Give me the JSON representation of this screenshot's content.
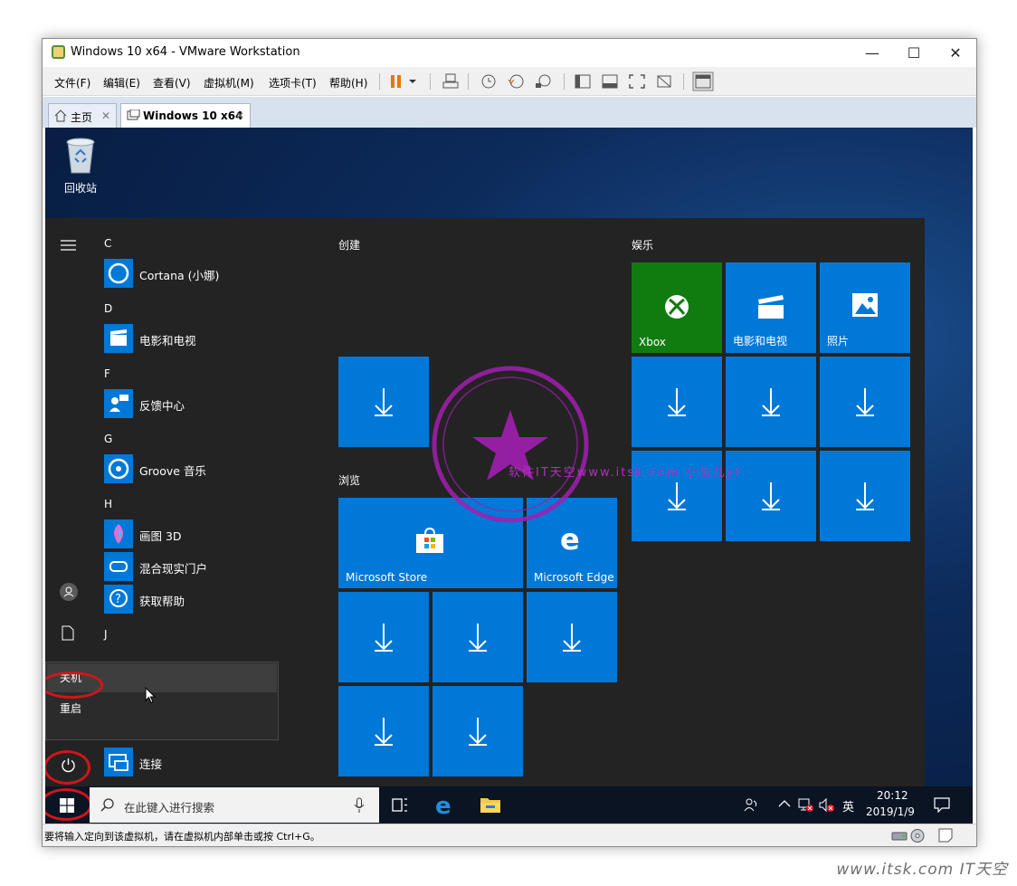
{
  "window": {
    "title": "Windows 10 x64 - VMware Workstation",
    "minimize": "—",
    "maximize": "☐",
    "close": "✕"
  },
  "menus": [
    "文件(F)",
    "编辑(E)",
    "查看(V)",
    "虚拟机(M)",
    "选项卡(T)",
    "帮助(H)"
  ],
  "tabs": [
    {
      "label": "主页",
      "close": "✕"
    },
    {
      "label": "Windows 10 x64",
      "close": "✕"
    }
  ],
  "desktop": {
    "recycle_bin": "回收站"
  },
  "app_list": {
    "letters": [
      "C",
      "D",
      "F",
      "G",
      "H",
      "J"
    ],
    "apps": [
      "Cortana (小娜)",
      "电影和电视",
      "反馈中心",
      "Groove 音乐",
      "画图 3D",
      "混合现实门户",
      "获取帮助",
      "连接"
    ]
  },
  "groups": {
    "create": "创建",
    "browse": "浏览",
    "entertainment": "娱乐"
  },
  "tiles": {
    "xbox": "Xbox",
    "movies": "电影和电视",
    "photos": "照片",
    "store": "Microsoft Store",
    "edge": "Microsoft Edge"
  },
  "power_menu": {
    "shutdown": "关机",
    "restart": "重启"
  },
  "taskbar": {
    "search_placeholder": "在此键入进行搜索",
    "ime": "英",
    "time": "20:12",
    "date": "2019/1/9"
  },
  "status": {
    "message": "要将输入定向到该虚拟机，请在虚拟机内部单击或按 Ctrl+G。"
  },
  "watermark": {
    "stamp_text": "软件IT天空www.itsk.com 小鱼儿yr",
    "footer": "www.itsk.com IT天空"
  },
  "colors": {
    "tile_blue": "#0078d7",
    "xbox_green": "#107c10",
    "start_bg": "#232323",
    "highlight_ring": "#d0161b"
  }
}
